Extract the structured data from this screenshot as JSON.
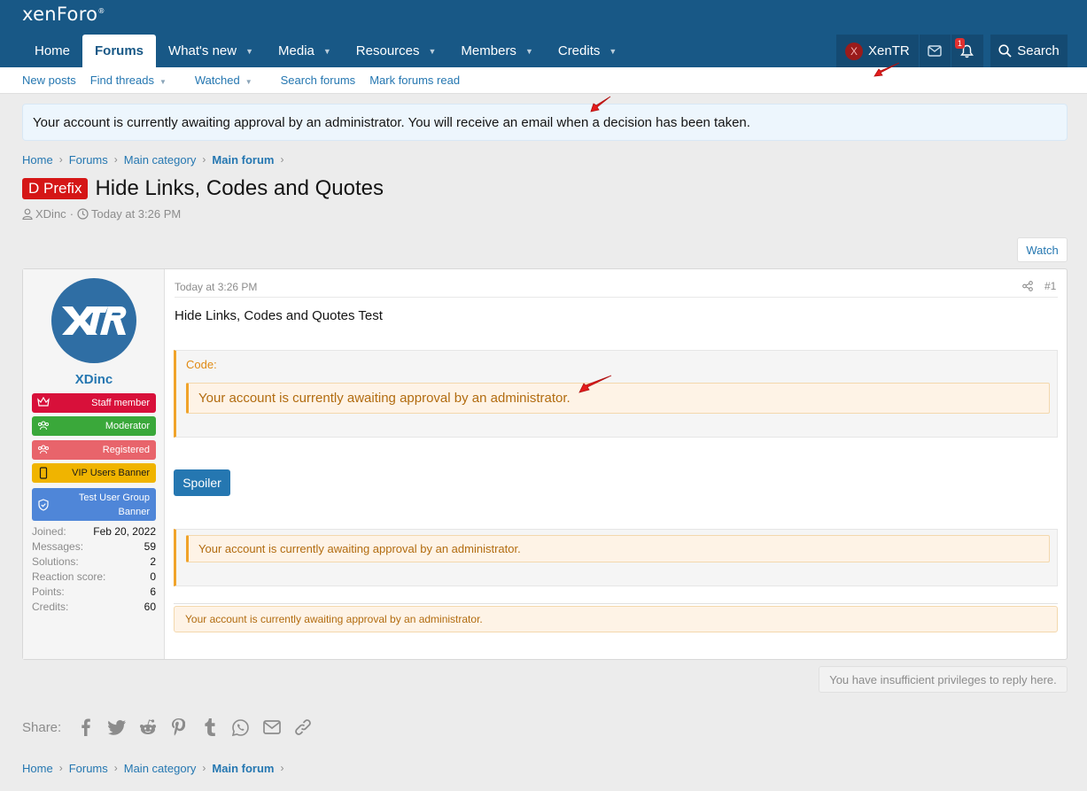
{
  "brand": {
    "logo_text": "xenForo",
    "logo_mark": "®"
  },
  "nav": {
    "tabs": [
      {
        "label": "Home",
        "caret": false,
        "active": false
      },
      {
        "label": "Forums",
        "caret": false,
        "active": true
      },
      {
        "label": "What's new",
        "caret": true,
        "active": false
      },
      {
        "label": "Media",
        "caret": true,
        "active": false
      },
      {
        "label": "Resources",
        "caret": true,
        "active": false
      },
      {
        "label": "Members",
        "caret": true,
        "active": false
      },
      {
        "label": "Credits",
        "caret": true,
        "active": false
      }
    ],
    "user": {
      "avatar_letter": "X",
      "name": "XenTR"
    },
    "alerts_count": "1",
    "search_label": "Search"
  },
  "subnav": {
    "items": [
      {
        "label": "New posts",
        "caret": false
      },
      {
        "label": "Find threads",
        "caret": true
      },
      {
        "label": "Watched",
        "caret": true
      },
      {
        "label": "Search forums",
        "caret": false
      },
      {
        "label": "Mark forums read",
        "caret": false
      }
    ]
  },
  "notice": "Your account is currently awaiting approval by an administrator. You will receive an email when a decision has been taken.",
  "breadcrumb": [
    "Home",
    "Forums",
    "Main category",
    "Main forum"
  ],
  "thread": {
    "prefix": "D Prefix",
    "title": "Hide Links, Codes and Quotes",
    "author": "XDinc",
    "date": "Today at 3:26 PM",
    "watch_label": "Watch"
  },
  "post": {
    "user": {
      "name": "XDinc",
      "banners": [
        {
          "label": "Staff member",
          "color": "#d8103a",
          "icon": "crown-icon"
        },
        {
          "label": "Moderator",
          "color": "#3aa83a",
          "icon": "users-icon"
        },
        {
          "label": "Registered",
          "color": "#e8646b",
          "icon": "users-icon"
        },
        {
          "label": "VIP Users Banner",
          "color": "#f0b400",
          "icon": "mobile-icon"
        },
        {
          "label": "Test User Group Banner",
          "color": "#4f86d8",
          "icon": "shield-icon"
        }
      ],
      "stats": [
        {
          "key": "Joined:",
          "value": "Feb 20, 2022"
        },
        {
          "key": "Messages:",
          "value": "59"
        },
        {
          "key": "Solutions:",
          "value": "2"
        },
        {
          "key": "Reaction score:",
          "value": "0"
        },
        {
          "key": "Points:",
          "value": "6"
        },
        {
          "key": "Credits:",
          "value": "60"
        }
      ]
    },
    "date": "Today at 3:26 PM",
    "number": "#1",
    "body_text": "Hide Links, Codes and Quotes Test",
    "code_label": "Code:",
    "code_content": "Your account is currently awaiting approval by an administrator.",
    "spoiler_label": "Spoiler",
    "hidden_quote": "Your account is currently awaiting approval by an administrator.",
    "hidden_simple": "Your account is currently awaiting approval by an administrator."
  },
  "no_reply": "You have insufficient privileges to reply here.",
  "share": {
    "label": "Share:",
    "icons": [
      "facebook-icon",
      "twitter-icon",
      "reddit-icon",
      "pinterest-icon",
      "tumblr-icon",
      "whatsapp-icon",
      "email-icon",
      "link-icon"
    ]
  },
  "colors": {
    "header": "#185886",
    "accent": "#2577b1",
    "prefix": "#d51616",
    "code_accent": "#f0a32a"
  }
}
